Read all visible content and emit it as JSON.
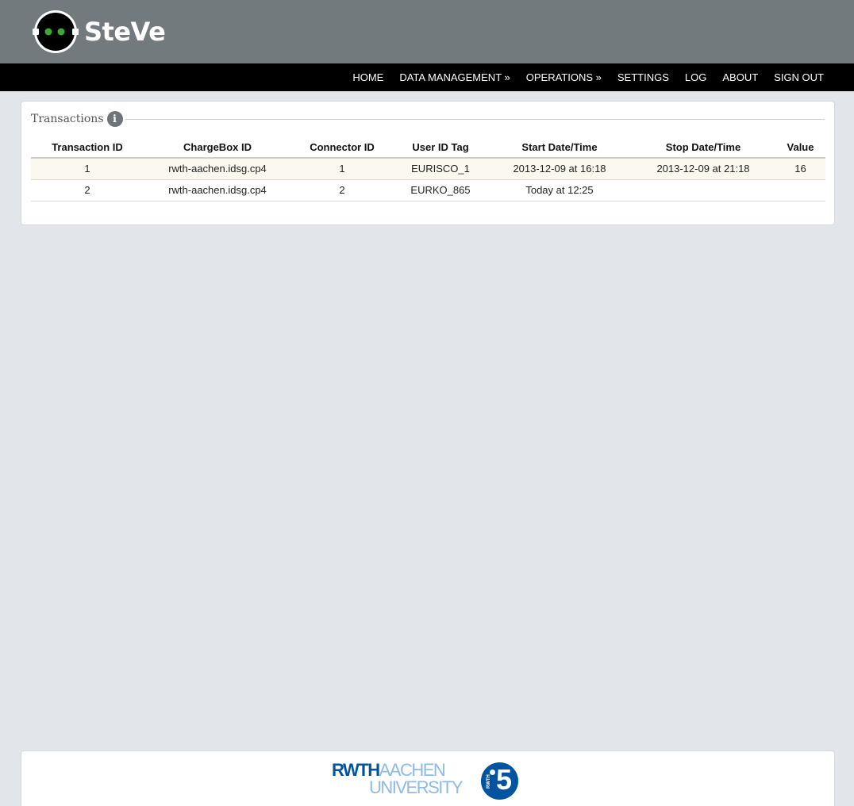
{
  "header": {
    "app_name": "SteVe",
    "logo_icon": "robot-face-icon"
  },
  "nav": {
    "items": [
      {
        "label": "HOME"
      },
      {
        "label": "DATA MANAGEMENT »"
      },
      {
        "label": "OPERATIONS »"
      },
      {
        "label": "SETTINGS"
      },
      {
        "label": "LOG"
      },
      {
        "label": "ABOUT"
      },
      {
        "label": "SIGN OUT"
      }
    ]
  },
  "transactions": {
    "title": "Transactions",
    "info_icon": "info-icon",
    "columns": [
      "Transaction ID",
      "ChargeBox ID",
      "Connector ID",
      "User ID Tag",
      "Start Date/Time",
      "Stop Date/Time",
      "Value"
    ],
    "rows": [
      [
        "1",
        "rwth-aachen.idsg.cp4",
        "1",
        "EURISCO_1",
        "2013-12-09 at 16:18",
        "2013-12-09 at 21:18",
        "16"
      ],
      [
        "2",
        "rwth-aachen.idsg.cp4",
        "2",
        "EURKO_865",
        "Today at 12:25",
        "",
        ""
      ]
    ]
  },
  "footer": {
    "logo_line1_bold": "RWTH",
    "logo_line1_light": "AACHEN",
    "logo_line2": "UNIVERSITY",
    "badge_text": "RWTH",
    "badge_number": "5"
  },
  "colors": {
    "header_bg": "#737a7d",
    "nav_bg": "#000000",
    "page_bg": "#e2e6ea",
    "logo_eyes": "#3aa935",
    "rwth_blue": "#00549f",
    "rwth_light_blue": "#8ebae5"
  }
}
